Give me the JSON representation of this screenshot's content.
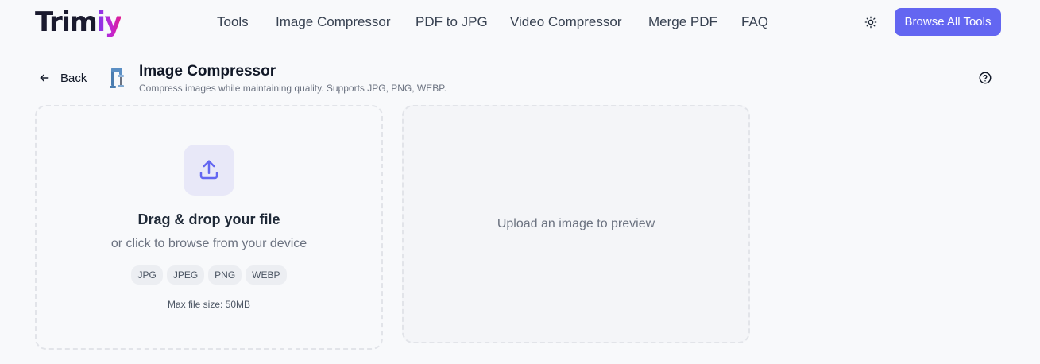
{
  "header": {
    "logo_part1": "Trim",
    "logo_part2": "iy",
    "nav": [
      "Tools",
      "Image Compressor",
      "PDF to JPG",
      "Video Compressor",
      "Merge PDF",
      "FAQ"
    ],
    "theme_icon": "sun-icon",
    "browse_label": "Browse All Tools"
  },
  "page": {
    "back_label": "Back",
    "title": "Image Compressor",
    "subtitle": "Compress images while maintaining quality. Supports JPG, PNG, WEBP.",
    "tool_icon": "clamp-icon",
    "help_icon": "help-circle-icon"
  },
  "upload": {
    "icon": "upload-icon",
    "title": "Drag & drop your file",
    "subtitle": "or click to browse from your device",
    "formats": [
      "JPG",
      "JPEG",
      "PNG",
      "WEBP"
    ],
    "max_size": "Max file size: 50MB"
  },
  "preview": {
    "placeholder": "Upload an image to preview"
  },
  "colors": {
    "accent": "#6366f1",
    "background": "#f8f9fb",
    "logo_gradient_start": "#7c3aed",
    "logo_gradient_end": "#e11d8f"
  }
}
